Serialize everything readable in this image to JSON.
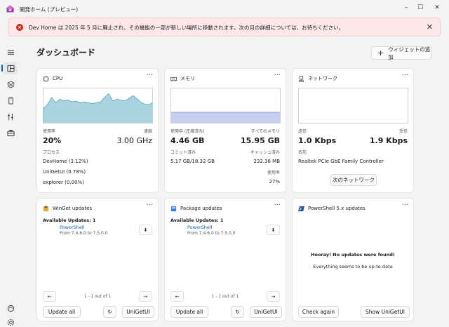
{
  "window": {
    "title": "開発ホーム (プレビュー)",
    "min_glyph": "–",
    "max_glyph": "☐",
    "close_glyph": "✕"
  },
  "banner": {
    "text": "Dev Home は 2025 年 5 月に廃止され、その機能の一部が新しい場所に移動されます。次の月の詳細については、お待ちください。",
    "close_glyph": "✕",
    "icon_glyph": "×"
  },
  "page": {
    "title": "ダッシュボード",
    "add_widget_label": "ウィジェットの追加",
    "add_glyph": "+"
  },
  "menu_glyph": "···",
  "cpu": {
    "title": "CPU",
    "usage_label": "使用率",
    "usage_value": "20%",
    "speed_label": "速度",
    "speed_value": "3.00 GHz",
    "process_label": "プロセス",
    "processes": [
      "DevHome (3.12%)",
      "UniGetUI (0.78%)",
      "explorer (0.00%)"
    ],
    "graph_color": "#a9d3df",
    "graph_line": "#4fa2b8"
  },
  "memory": {
    "title": "メモリ",
    "used_label": "使用中 (圧縮済み)",
    "used_value": "4.46 GB",
    "total_label": "すべてのメモリ",
    "total_value": "15.95 GB",
    "commit_label": "コミット済み",
    "commit_value": "5.17 GB/18.32 GB",
    "cache_label": "キャッシュ済み",
    "cache_value": "232.36 MB",
    "rate_label": "使用率",
    "rate_value": "27%",
    "graph_color": "#c7cfee",
    "graph_line": "#7e8fd6"
  },
  "network": {
    "title": "ネットワーク",
    "send_label": "送信",
    "send_value": "1.0 Kbps",
    "recv_label": "受信",
    "recv_value": "1.9 Kbps",
    "name_label": "名前",
    "name_value": "Realtek PCIe GbE Family Controller",
    "next_button": "次のネットワーク",
    "graph_line": "#e48a8a"
  },
  "winget": {
    "title": "WinGet updates",
    "available": "Available Updates: 1",
    "app": "PowerShell",
    "version": "From 7.4.6.0 to 7.5.0.0",
    "pager": "1 - 1 out of 1",
    "update_all": "Update all",
    "open_app": "UniGetUI"
  },
  "package": {
    "title": "Package updates",
    "available": "Available Updates: 1",
    "app": "PowerShell",
    "version": "From 7.4.6.0 to 7.5.0.0",
    "pager": "1 - 1 out of 1",
    "update_all": "Update all",
    "open_app": "UniGetUI"
  },
  "powershell": {
    "title": "PowerShell 5.x updates",
    "hooray": "Hooray! No updates were found!",
    "uptodate": "Everything seems to be up-to-date",
    "check_again": "Check again",
    "show_app": "Show UniGetUI"
  },
  "glyphs": {
    "prev": "←",
    "next": "→",
    "refresh": "↻",
    "download": "⬇"
  }
}
